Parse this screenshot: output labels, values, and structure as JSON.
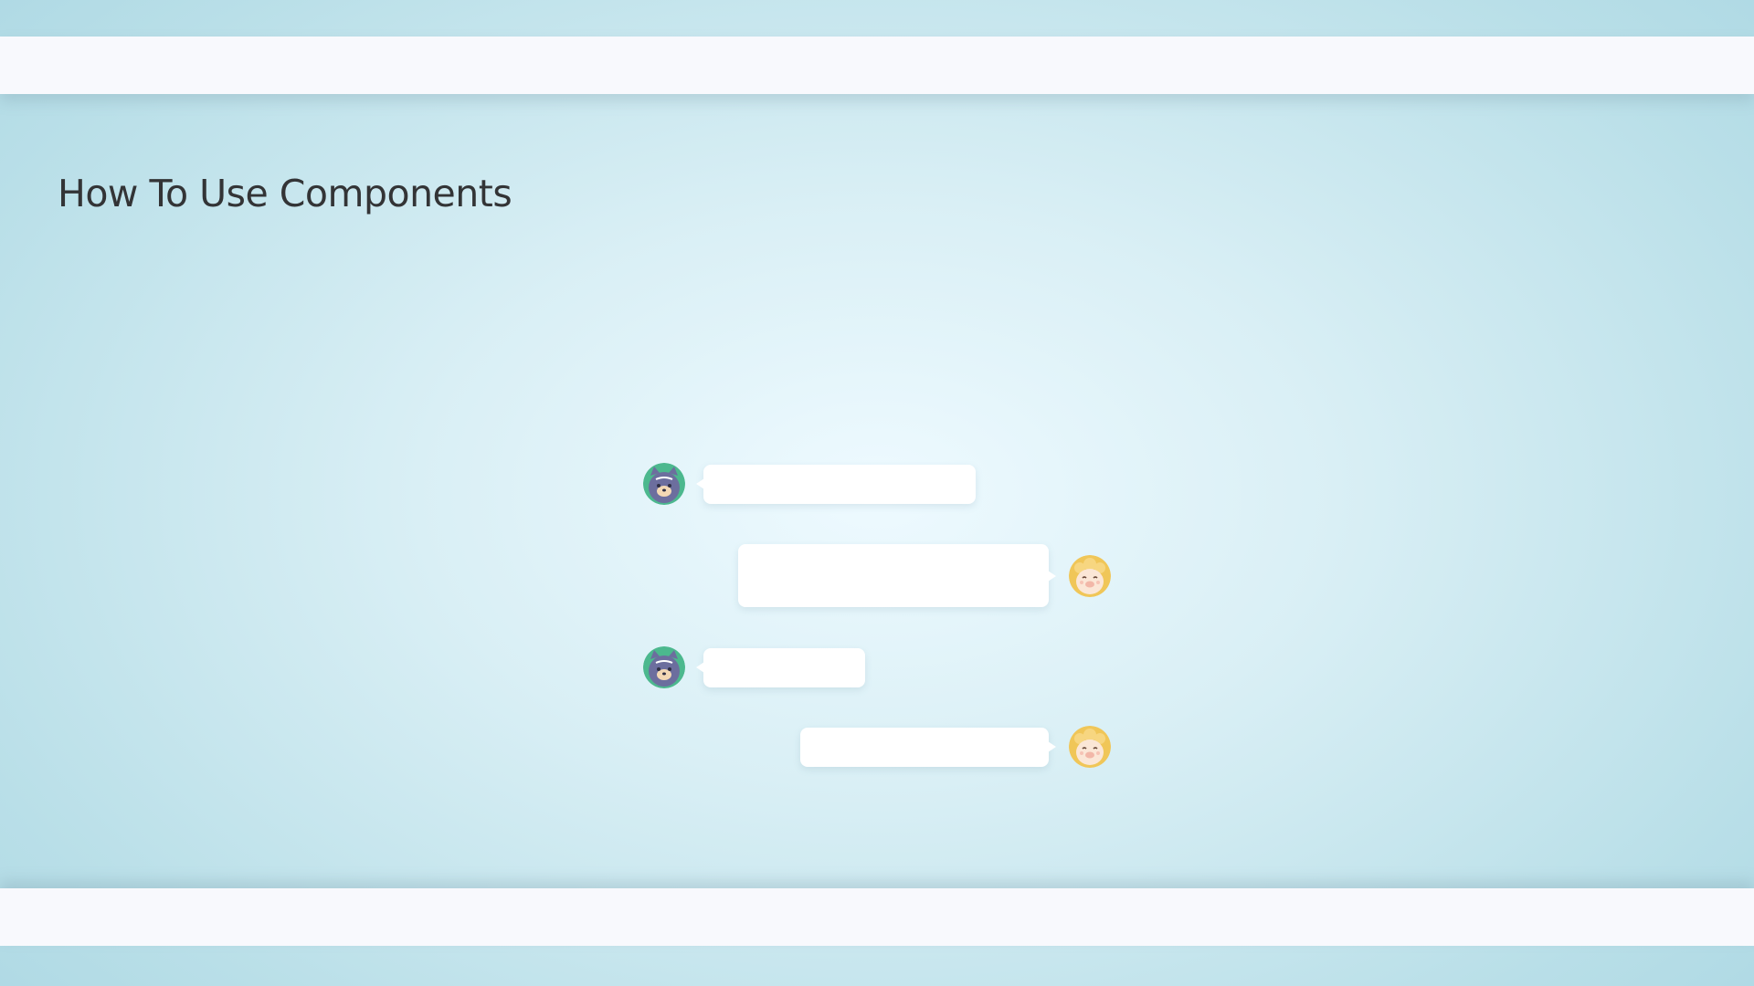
{
  "page": {
    "title": "How To Use Components"
  },
  "colors": {
    "background_center": "#eefaff",
    "background_edge": "#a9d6e2",
    "band": "#f8f9fd",
    "title_text": "#333436",
    "bubble": "#ffffff",
    "avatar_cat_bg": "#4cb88e",
    "avatar_cat_face": "#6c6e9e",
    "avatar_sheep_bg": "#f0c658",
    "avatar_sheep_face": "#fbe6d6"
  },
  "chat": {
    "messages": [
      {
        "side": "left",
        "avatar": "cat-avatar-icon",
        "text": ""
      },
      {
        "side": "right",
        "avatar": "sheep-avatar-icon",
        "text": ""
      },
      {
        "side": "left",
        "avatar": "cat-avatar-icon",
        "text": ""
      },
      {
        "side": "right",
        "avatar": "sheep-avatar-icon",
        "text": ""
      }
    ]
  }
}
